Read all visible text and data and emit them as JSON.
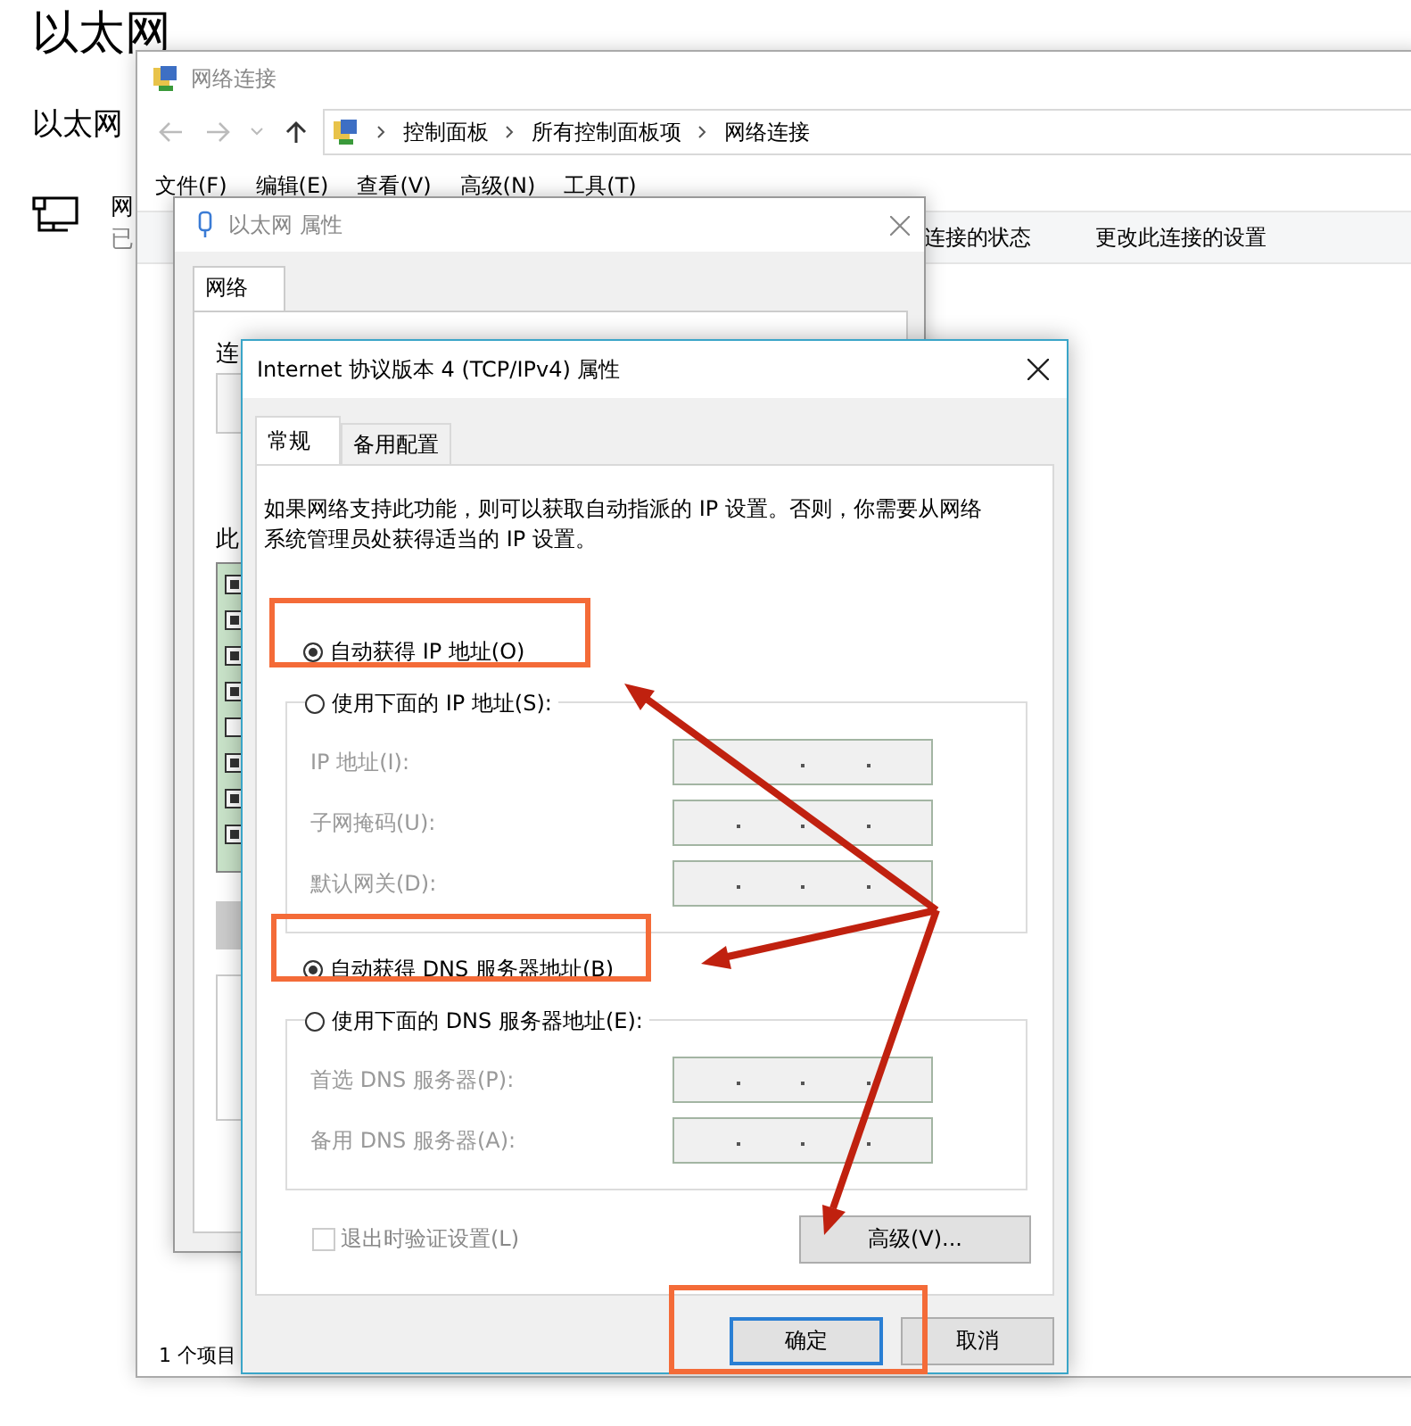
{
  "settings_page": {
    "title": "以太网",
    "subtitle": "以太网",
    "adapter_name": "网",
    "adapter_status": "已"
  },
  "network_connections": {
    "title": "网络连接",
    "breadcrumb": [
      "控制面板",
      "所有控制面板项",
      "网络连接"
    ],
    "menu": [
      "文件(F)",
      "编辑(E)",
      "查看(V)",
      "高级(N)",
      "工具(T)"
    ],
    "commands": [
      "连接的状态",
      "更改此连接的设置"
    ],
    "status_bar": "1 个项目"
  },
  "ethernet_properties": {
    "title": "以太网 属性",
    "tabs": [
      {
        "label": "网络",
        "selected": true
      }
    ],
    "label_1": "连",
    "label_2": "此",
    "components": [
      {
        "checked": true
      },
      {
        "checked": true
      },
      {
        "checked": true
      },
      {
        "checked": true
      },
      {
        "checked": false
      },
      {
        "checked": true
      },
      {
        "checked": true
      },
      {
        "checked": true
      }
    ]
  },
  "ipv4_dialog": {
    "title": "Internet 协议版本 4 (TCP/IPv4) 属性",
    "tabs": [
      {
        "label": "常规",
        "selected": true
      },
      {
        "label": "备用配置",
        "selected": false
      }
    ],
    "description": "如果网络支持此功能，则可以获取自动指派的 IP 设置。否则，你需要从网络系统管理员处获得适当的 IP 设置。",
    "ip_options": [
      {
        "label": "自动获得 IP 地址(O)",
        "selected": true
      },
      {
        "label": "使用下面的 IP 地址(S):",
        "selected": false
      }
    ],
    "ip_fields": [
      {
        "label": "IP 地址(I):",
        "disabled": true
      },
      {
        "label": "子网掩码(U):",
        "disabled": true
      },
      {
        "label": "默认网关(D):",
        "disabled": true
      }
    ],
    "dns_options": [
      {
        "label": "自动获得 DNS 服务器地址(B)",
        "selected": true
      },
      {
        "label": "使用下面的 DNS 服务器地址(E):",
        "selected": false
      }
    ],
    "dns_fields": [
      {
        "label": "首选 DNS 服务器(P):",
        "disabled": true
      },
      {
        "label": "备用 DNS 服务器(A):",
        "disabled": true
      }
    ],
    "validate": {
      "label": "退出时验证设置(L)",
      "checked": false,
      "disabled": true
    },
    "advanced_button": "高级(V)...",
    "buttons": [
      {
        "label": "确定",
        "default": true
      },
      {
        "label": "取消",
        "default": false
      }
    ]
  }
}
